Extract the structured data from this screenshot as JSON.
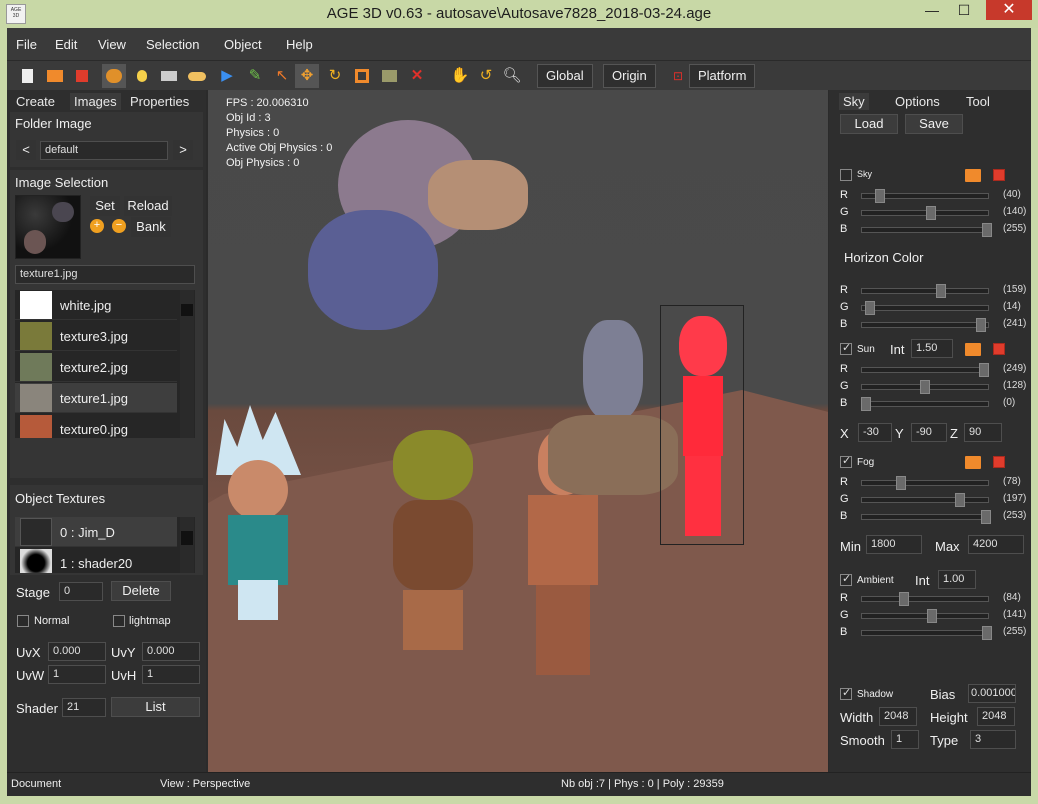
{
  "titlebar": {
    "title": "AGE 3D v0.63 - autosave\\Autosave7828_2018-03-24.age",
    "icon_text": "AGE 3D",
    "minimize": "—",
    "maximize": "☐",
    "close": "✕"
  },
  "menu": [
    "File",
    "Edit",
    "View",
    "Selection",
    "Object",
    "Help"
  ],
  "toolbar": {
    "icons": [
      "new-file-icon",
      "open-folder-icon",
      "save-icon",
      "character-icon",
      "light-bulb-icon",
      "camera-icon",
      "cloud-icon",
      "play-icon",
      "pencil-icon",
      "cursor-icon",
      "move-icon",
      "rotate-icon",
      "scale-icon",
      "terrain-icon",
      "delete-icon",
      "hand-icon",
      "undo-icon",
      "zoom-icon"
    ],
    "global": "Global",
    "origin": "Origin",
    "platform": "Platform"
  },
  "left_panel": {
    "tabs": [
      "Create",
      "Images",
      "Properties"
    ],
    "folder_image": {
      "title": "Folder Image",
      "prev": "<",
      "next": ">",
      "value": "default"
    },
    "image_selection": {
      "title": "Image Selection",
      "set": "Set",
      "reload": "Reload",
      "bank": "Bank",
      "current": "texture1.jpg"
    },
    "image_list": [
      {
        "name": "white.jpg",
        "color": "#ffffff"
      },
      {
        "name": "texture3.jpg",
        "color": "#7a7a3a"
      },
      {
        "name": "texture2.jpg",
        "color": "#6f7a5a"
      },
      {
        "name": "texture1.jpg",
        "color": "#8a857c"
      },
      {
        "name": "texture0.jpg",
        "color": "#b65a3a"
      }
    ],
    "object_textures": {
      "title": "Object Textures",
      "items": [
        {
          "name": "0 : Jim_D"
        },
        {
          "name": "1 : shader20"
        }
      ]
    },
    "stage_label": "Stage",
    "stage_value": "0",
    "delete": "Delete",
    "normal": "Normal",
    "lightmap": "lightmap",
    "uvx_label": "UvX",
    "uvx": "0.000",
    "uvy_label": "UvY",
    "uvy": "0.000",
    "uvw_label": "UvW",
    "uvw": "1",
    "uvh_label": "UvH",
    "uvh": "1",
    "shader_label": "Shader",
    "shader": "21",
    "list": "List"
  },
  "viewport": {
    "stats": [
      "FPS : 20.006310",
      "Obj Id : 3",
      "Physics : 0",
      "Active Obj Physics : 0",
      "Obj Physics : 0"
    ]
  },
  "right_panel": {
    "tabs": [
      "Sky",
      "Options",
      "Tool"
    ],
    "load": "Load",
    "save": "Save",
    "sky": {
      "label": "Sky",
      "checked": false,
      "r": 40,
      "g": 140,
      "b": 255
    },
    "horizon": {
      "title": "Horizon Color",
      "r": 159,
      "g": 14,
      "b": 241
    },
    "sun": {
      "label": "Sun",
      "checked": true,
      "int_label": "Int",
      "int": "1.50",
      "r": 249,
      "g": 128,
      "b": 0,
      "x_label": "X",
      "x": "-30",
      "y_label": "Y",
      "y": "-90",
      "z_label": "Z",
      "z": "90"
    },
    "fog": {
      "label": "Fog",
      "checked": true,
      "r": 78,
      "g": 197,
      "b": 253,
      "min_label": "Min",
      "min": "1800",
      "max_label": "Max",
      "max": "4200"
    },
    "ambient": {
      "label": "Ambient",
      "checked": true,
      "int_label": "Int",
      "int": "1.00",
      "r": 84,
      "g": 141,
      "b": 255
    },
    "shadow": {
      "label": "Shadow",
      "checked": true,
      "bias_label": "Bias",
      "bias": "0.001000",
      "width_label": "Width",
      "width": "2048",
      "height_label": "Height",
      "height": "2048",
      "smooth_label": "Smooth",
      "smooth": "1",
      "type_label": "Type",
      "type": "3"
    },
    "r_label": "R",
    "g_label": "G",
    "b_label": "B"
  },
  "status": {
    "document": "Document",
    "view": "View : Perspective",
    "counts": "Nb obj :7 | Phys : 0 | Poly : 29359"
  }
}
